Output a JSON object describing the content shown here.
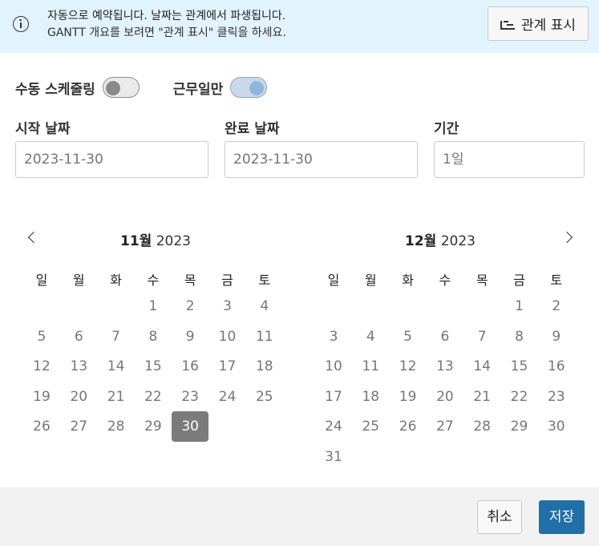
{
  "banner": {
    "line1": "자동으로 예약됩니다. 날짜는 관계에서 파생됩니다.",
    "line2": "GANTT 개요를 보려면 \"관계 표시\" 클릭을 하세요.",
    "button_label": "관계 표시"
  },
  "toggles": {
    "manual_label": "수동 스케줄링",
    "manual_on": false,
    "workdays_label": "근무일만",
    "workdays_on": true
  },
  "fields": {
    "start_label": "시작 날짜",
    "start_placeholder": "2023-11-30",
    "end_label": "완료 날짜",
    "end_placeholder": "2023-11-30",
    "duration_label": "기간",
    "duration_placeholder": "1일"
  },
  "weekdays": [
    "일",
    "월",
    "화",
    "수",
    "목",
    "금",
    "토"
  ],
  "calendars": [
    {
      "month": "11월",
      "year": "2023",
      "first_weekday": 3,
      "days": 30,
      "selected": 30
    },
    {
      "month": "12월",
      "year": "2023",
      "first_weekday": 5,
      "days": 31,
      "selected": null
    }
  ],
  "footer": {
    "cancel_label": "취소",
    "save_label": "저장"
  }
}
